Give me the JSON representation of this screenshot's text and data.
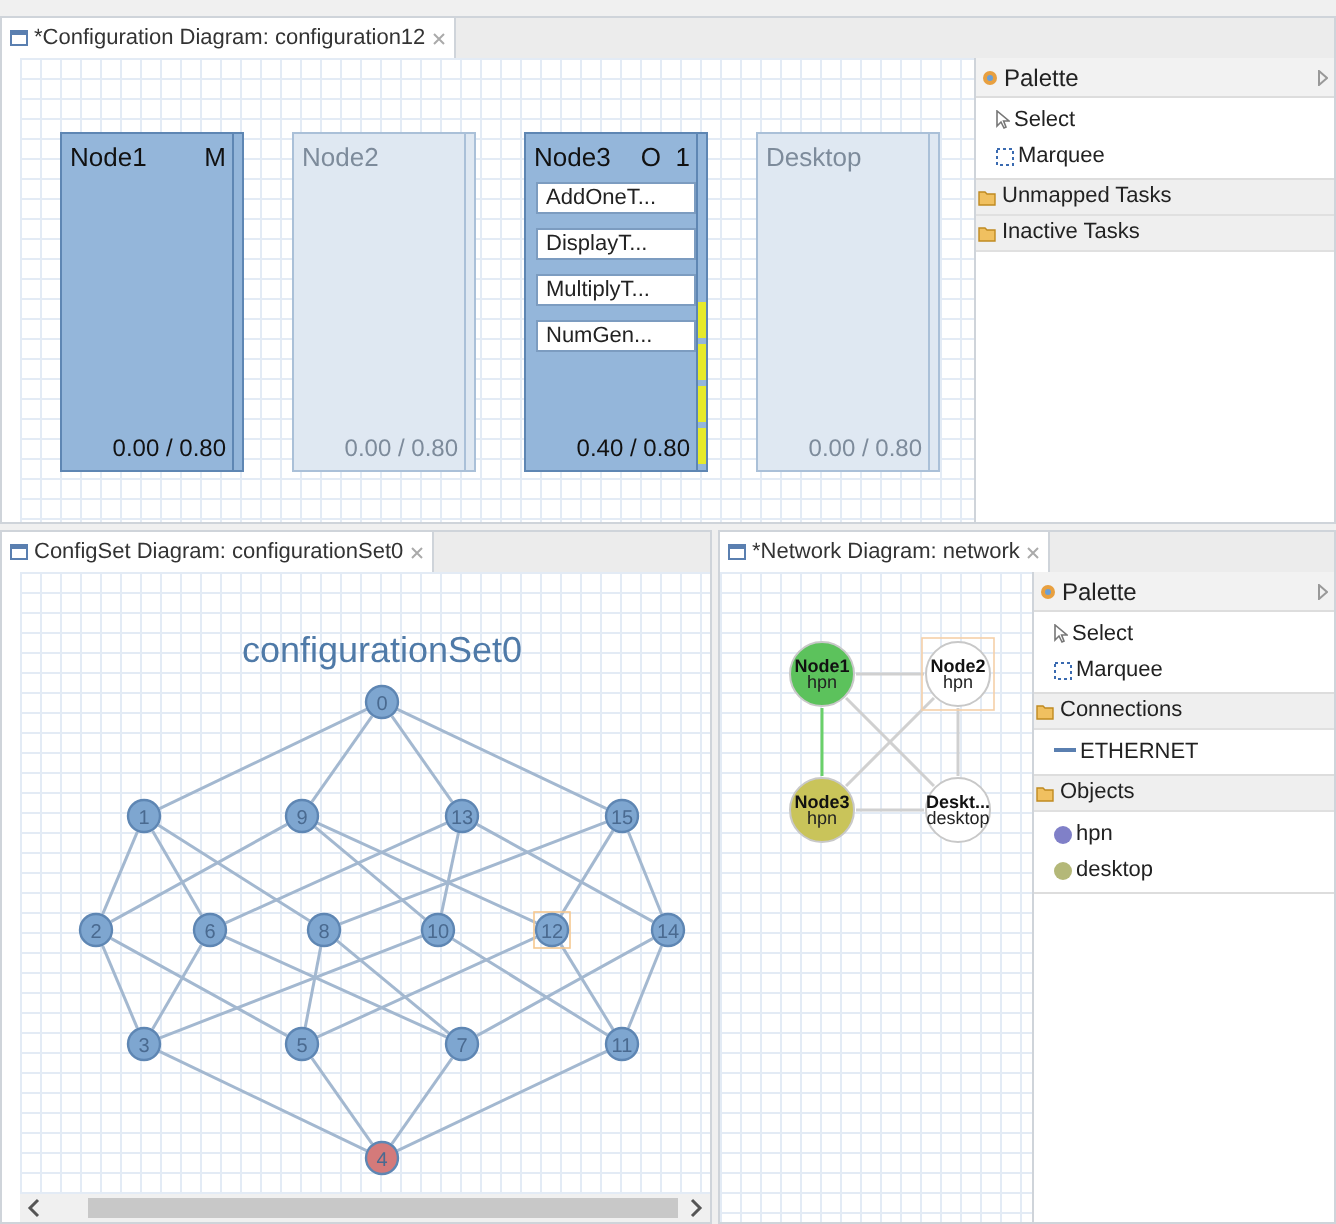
{
  "configuration_editor": {
    "tab": {
      "title": "*Configuration Diagram: configuration12",
      "selected": true
    },
    "nodes": [
      {
        "name": "Node1",
        "badge": "M",
        "active": true,
        "load": "0.00 / 0.80"
      },
      {
        "name": "Node2",
        "active": false,
        "load": "0.00 / 0.80"
      },
      {
        "name": "Node3",
        "badge": "O  1",
        "active": true,
        "load": "0.40 / 0.80",
        "level": 0.5,
        "tasks": [
          {
            "label": "AddOneT..."
          },
          {
            "label": "DisplayT..."
          },
          {
            "label": "MultiplyT..."
          },
          {
            "label": "NumGen..."
          }
        ]
      },
      {
        "name": "Desktop",
        "active": false,
        "load": "0.00 / 0.80"
      }
    ],
    "palette": {
      "title": "Palette",
      "tools": [
        {
          "label": "Select",
          "kind": "select"
        },
        {
          "label": "Marquee",
          "kind": "marquee"
        }
      ],
      "drawers": [
        {
          "title": "Unmapped Tasks"
        },
        {
          "title": "Inactive Tasks"
        }
      ]
    }
  },
  "configset_editor": {
    "tab": {
      "title": "ConfigSet Diagram: configurationSet0",
      "selected": true
    },
    "diagram_title": "configurationSet0",
    "nodes": [
      {
        "label": "0",
        "color": "#7ea6d0",
        "selected": false
      },
      {
        "label": "1",
        "color": "#7ea6d0",
        "selected": false
      },
      {
        "label": "9",
        "color": "#7ea6d0",
        "selected": false
      },
      {
        "label": "13",
        "color": "#7ea6d0",
        "selected": false
      },
      {
        "label": "15",
        "color": "#7ea6d0",
        "selected": false
      },
      {
        "label": "2",
        "color": "#7ea6d0",
        "selected": false
      },
      {
        "label": "6",
        "color": "#7ea6d0",
        "selected": false
      },
      {
        "label": "8",
        "color": "#7ea6d0",
        "selected": false
      },
      {
        "label": "10",
        "color": "#7ea6d0",
        "selected": false
      },
      {
        "label": "12",
        "color": "#7ea6d0",
        "selected": true
      },
      {
        "label": "14",
        "color": "#7ea6d0",
        "selected": false
      },
      {
        "label": "3",
        "color": "#7ea6d0",
        "selected": false
      },
      {
        "label": "5",
        "color": "#7ea6d0",
        "selected": false
      },
      {
        "label": "7",
        "color": "#7ea6d0",
        "selected": false
      },
      {
        "label": "11",
        "color": "#7ea6d0",
        "selected": false
      },
      {
        "label": "4",
        "color": "#d47a7a",
        "selected": false
      }
    ]
  },
  "network_editor": {
    "tab": {
      "title": "*Network Diagram: network",
      "selected": true
    },
    "nodes": [
      {
        "name": "Node1",
        "type": "hpn",
        "color": "#5cc25c",
        "selected": false
      },
      {
        "name": "Node2",
        "type": "hpn",
        "color": "#ffffff",
        "selected": true
      },
      {
        "name": "Node3",
        "type": "hpn",
        "color": "#c9c45a",
        "selected": false
      },
      {
        "name": "Deskt...",
        "type": "desktop",
        "color": "#ffffff",
        "selected": false
      }
    ],
    "palette": {
      "title": "Palette",
      "tools": [
        {
          "label": "Select",
          "kind": "select"
        },
        {
          "label": "Marquee",
          "kind": "marquee"
        }
      ],
      "drawers": [
        {
          "title": "Connections",
          "items": [
            {
              "label": "ETHERNET",
              "kind": "line",
              "color": "#5a7fb0"
            }
          ]
        },
        {
          "title": "Objects",
          "items": [
            {
              "label": "hpn",
              "kind": "dot",
              "color": "#8080c8"
            },
            {
              "label": "desktop",
              "kind": "dot",
              "color": "#b4b878"
            }
          ]
        }
      ]
    }
  }
}
